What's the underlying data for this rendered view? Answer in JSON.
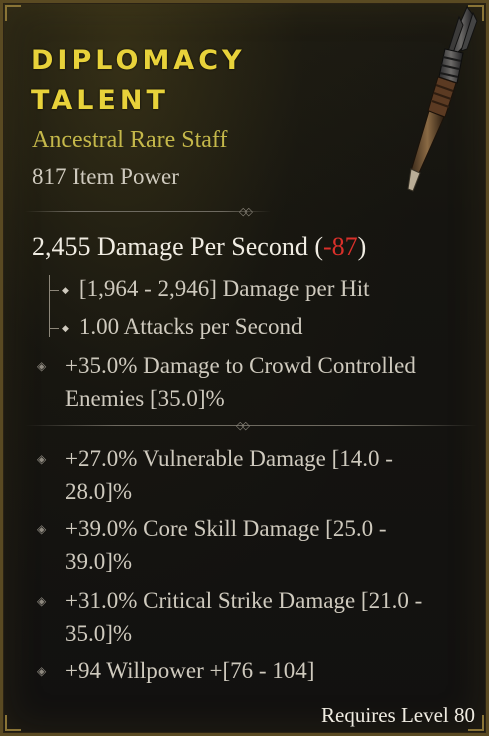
{
  "item": {
    "name_line1": "DIPLOMACY",
    "name_line2": "TALENT",
    "type": "Ancestral Rare Staff",
    "power": "817 Item Power",
    "weapon_icon": "staff-icon"
  },
  "stats": {
    "dps_text": "2,455 Damage Per Second",
    "dps_open": "(",
    "dps_diff": "-87",
    "dps_close": ")",
    "damage_per_hit": "[1,964 - 2,946] Damage per Hit",
    "attacks_per_second": "1.00 Attacks per Second"
  },
  "implicit_affixes": [
    {
      "line1": "+35.0% Damage to Crowd Controlled",
      "line2": "Enemies [35.0]%"
    }
  ],
  "affixes": [
    {
      "line1": "+27.0% Vulnerable Damage [14.0 -",
      "line2": "28.0]%"
    },
    {
      "line1": "+39.0% Core Skill Damage [25.0 -",
      "line2": "39.0]%"
    },
    {
      "line1": "+31.0% Critical Strike Damage [21.0 -",
      "line2": "35.0]%"
    },
    {
      "line1": "+94 Willpower +[76 - 104]",
      "line2": ""
    }
  ],
  "requirement": "Requires Level 80",
  "colors": {
    "legendary_name": "#e8d23a",
    "rare_type": "#c5b84a",
    "body_text": "#cfcabe",
    "negative_diff": "#d9302a",
    "frame": "#5a4a22"
  }
}
